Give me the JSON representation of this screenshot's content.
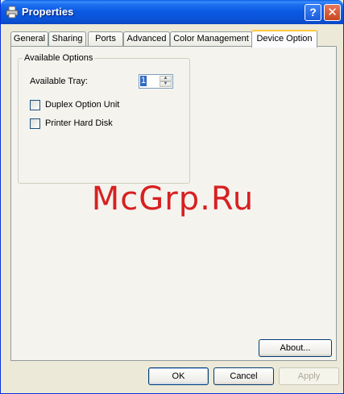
{
  "window": {
    "title": "Properties"
  },
  "tabs": [
    {
      "label": "General"
    },
    {
      "label": "Sharing"
    },
    {
      "label": "Ports"
    },
    {
      "label": "Advanced"
    },
    {
      "label": "Color Management"
    },
    {
      "label": "Device Option",
      "active": true
    }
  ],
  "options": {
    "group_label": "Available Options",
    "tray_label": "Available Tray:",
    "tray_value": "1",
    "duplex_label": "Duplex Option Unit",
    "duplex_checked": false,
    "harddisk_label": "Printer Hard Disk",
    "harddisk_checked": false
  },
  "watermark": "McGrp.Ru",
  "buttons": {
    "about": "About...",
    "ok": "OK",
    "cancel": "Cancel",
    "apply": "Apply"
  },
  "colors": {
    "title_bar": "#0a53d8",
    "close": "#c8461e",
    "watermark": "#d72020"
  }
}
